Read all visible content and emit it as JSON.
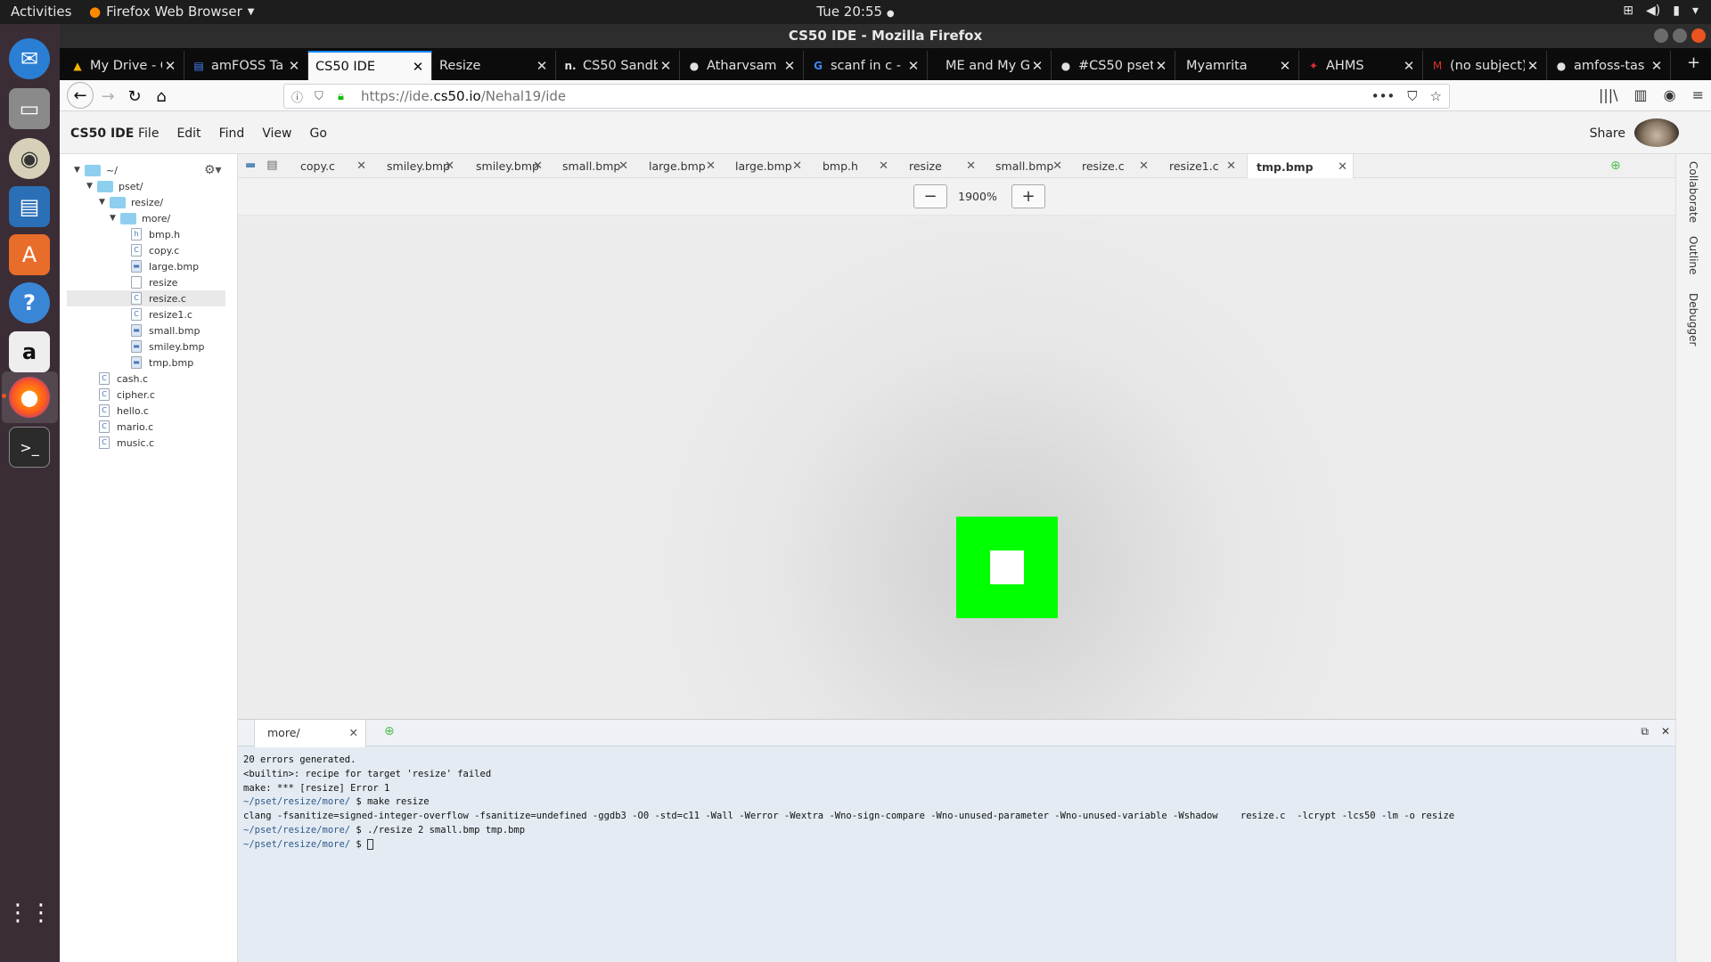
{
  "topbar": {
    "activities": "Activities",
    "app_name": "Firefox Web Browser",
    "clock": "Tue 20:55"
  },
  "window": {
    "title": "CS50 IDE - Mozilla Firefox"
  },
  "browser_tabs": [
    {
      "label": "My Drive - G",
      "icon": "google-drive-icon"
    },
    {
      "label": "amFOSS Ta",
      "icon": "docs-icon"
    },
    {
      "label": "CS50 IDE",
      "icon": "none",
      "active": true
    },
    {
      "label": "Resize",
      "icon": "none"
    },
    {
      "label": "CS50 Sandb",
      "icon": "n-icon"
    },
    {
      "label": "Atharvsam",
      "icon": "github-icon"
    },
    {
      "label": "scanf in c - G",
      "icon": "google-icon"
    },
    {
      "label": "ME and My G",
      "icon": "none"
    },
    {
      "label": "#CS50 pset",
      "icon": "github-icon"
    },
    {
      "label": "Myamrita",
      "icon": "none"
    },
    {
      "label": "AHMS",
      "icon": "ahms-icon"
    },
    {
      "label": "(no subject)",
      "icon": "gmail-icon"
    },
    {
      "label": "amfoss-tas",
      "icon": "github-icon"
    }
  ],
  "navbar": {
    "url_prefix": "https://ide.",
    "url_domain": "cs50.io",
    "url_path": "/Nehal19/ide"
  },
  "ide": {
    "brand": "CS50 IDE",
    "menus": [
      "File",
      "Edit",
      "Find",
      "View",
      "Go"
    ],
    "share": "Share",
    "tree": {
      "root": "~/",
      "pset": "pset/",
      "resize": "resize/",
      "more": "more/",
      "more_files": [
        {
          "name": "bmp.h",
          "kind": "h"
        },
        {
          "name": "copy.c",
          "kind": "c"
        },
        {
          "name": "large.bmp",
          "kind": "img"
        },
        {
          "name": "resize",
          "kind": "plain"
        },
        {
          "name": "resize.c",
          "kind": "c",
          "selected": true
        },
        {
          "name": "resize1.c",
          "kind": "c"
        },
        {
          "name": "small.bmp",
          "kind": "img"
        },
        {
          "name": "smiley.bmp",
          "kind": "img"
        },
        {
          "name": "tmp.bmp",
          "kind": "img"
        }
      ],
      "pset_files": [
        "cash.c",
        "cipher.c",
        "hello.c",
        "mario.c",
        "music.c"
      ]
    },
    "editor_tabs": [
      "copy.c",
      "smiley.bmp",
      "smiley.bmp",
      "small.bmp",
      "large.bmp",
      "large.bmp",
      "bmp.h",
      "resize",
      "small.bmp",
      "resize.c",
      "resize1.c",
      "tmp.bmp"
    ],
    "active_tab": "tmp.bmp",
    "zoom": "1900%",
    "image_colors": {
      "outer": "#00ff00",
      "inner": "#ffffff"
    },
    "right_rail": [
      "Collaborate",
      "Outline",
      "Debugger"
    ],
    "terminal": {
      "tab": "more/",
      "lines": [
        {
          "prompt": "",
          "text": "20 errors generated."
        },
        {
          "prompt": "",
          "text": "<builtin>: recipe for target 'resize' failed"
        },
        {
          "prompt": "",
          "text": "make: *** [resize] Error 1"
        },
        {
          "prompt": "~/pset/resize/more/",
          "text": " $ make resize"
        },
        {
          "prompt": "",
          "text": "clang -fsanitize=signed-integer-overflow -fsanitize=undefined -ggdb3 -O0 -std=c11 -Wall -Werror -Wextra -Wno-sign-compare -Wno-unused-parameter -Wno-unused-variable -Wshadow    resize.c  -lcrypt -lcs50 -lm -o resize"
        },
        {
          "prompt": "~/pset/resize/more/",
          "text": " $ ./resize 2 small.bmp tmp.bmp"
        },
        {
          "prompt": "~/pset/resize/more/",
          "text": " $ "
        }
      ]
    }
  }
}
